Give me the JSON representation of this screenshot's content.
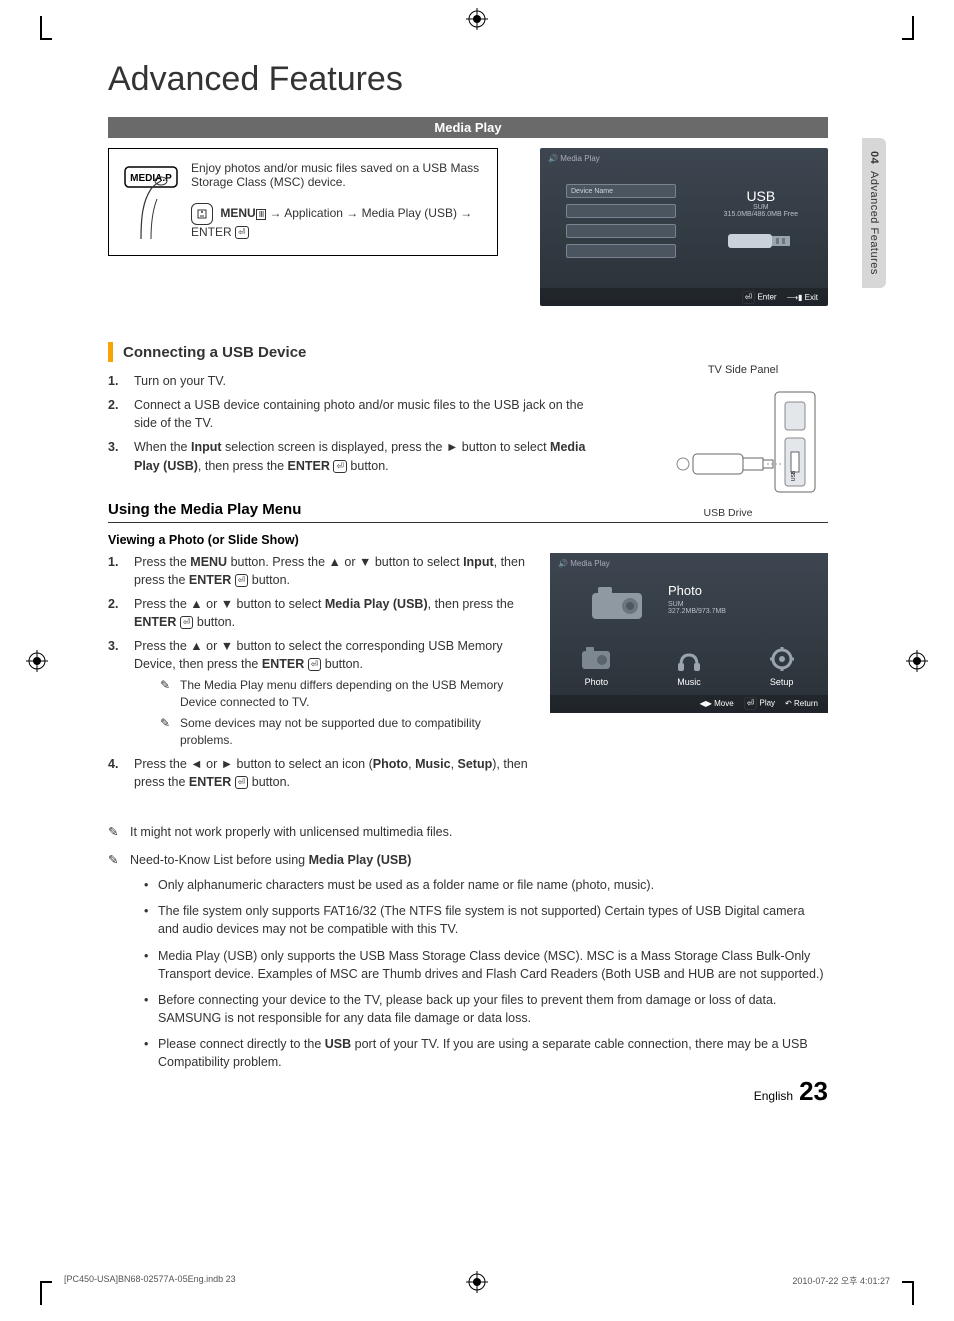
{
  "chapter": {
    "num": "04",
    "name": "Advanced Features"
  },
  "title": "Advanced Features",
  "section_bar": "Media Play",
  "intro": {
    "para": "Enjoy photos and/or music files saved on a USB Mass Storage Class (MSC) device.",
    "path_prefix": "MENU",
    "path_rest": " → Application → Media Play (USB) → ENTER",
    "remote_button_label": "MEDIA.P"
  },
  "screen1": {
    "header": "Media Play",
    "device_name": "Device Name",
    "usb": "USB",
    "sum_label": "SUM",
    "sum_value": "315.0MB/486.0MB Free",
    "enter": "Enter",
    "exit": "Exit"
  },
  "connect": {
    "heading": "Connecting a USB Device",
    "steps": [
      "Turn on your TV.",
      "Connect a USB device containing photo and/or music files to the USB jack on the side of the TV.",
      "When the Input selection screen is displayed, press the ► button to select Media Play (USB), then press the ENTER button."
    ],
    "caption": "TV Side Panel",
    "usb_drive": "USB Drive"
  },
  "using": {
    "heading": "Using the Media Play Menu",
    "sub": "Viewing a Photo (or Slide Show)",
    "steps": [
      "Press the MENU button. Press the ▲ or ▼ button to select Input, then press the ENTER button.",
      "Press the ▲ or ▼ button to select Media Play (USB), then press the ENTER button.",
      "Press the ▲ or ▼ button to select the corresponding USB Memory Device, then press the ENTER button.",
      "Press the ◄ or ► button to select an icon (Photo, Music, Setup), then press the ENTER button."
    ],
    "step3_notes": [
      "The Media Play menu differs depending on the USB Memory Device connected to TV.",
      "Some devices may not be supported due to compatibility problems."
    ]
  },
  "screen2": {
    "header": "Media Play",
    "photo": "Photo",
    "sum_label": "SUM",
    "sum_value": "327.2MB/973.7MB",
    "tiles": [
      "Photo",
      "Music",
      "Setup"
    ],
    "move": "Move",
    "play": "Play",
    "return": "Return"
  },
  "notes_top": [
    "It might not work properly with unlicensed multimedia files.",
    "Need-to-Know List before using Media Play (USB)"
  ],
  "bullets": [
    "Only alphanumeric characters must be used as a folder name or file name (photo, music).",
    "The file system only supports FAT16/32 (The NTFS file system is not supported) Certain types of USB Digital camera and audio devices may not be compatible with this TV.",
    "Media Play (USB) only supports the USB Mass Storage Class device (MSC). MSC is a Mass Storage Class Bulk-Only Transport device. Examples of MSC are Thumb drives and Flash Card Readers (Both USB and HUB are not supported.)",
    "Before connecting your device to the TV, please back up your files to prevent them from damage or loss of data. SAMSUNG is not responsible for any data file damage or data loss.",
    "Please connect directly to the USB port of your TV. If you are using a separate cable connection, there may be a USB Compatibility problem."
  ],
  "footer": {
    "lang": "English",
    "page": "23",
    "file": "[PC450-USA]BN68-02577A-05Eng.indb   23",
    "stamp": "2010-07-22   오후 4:01:27"
  }
}
